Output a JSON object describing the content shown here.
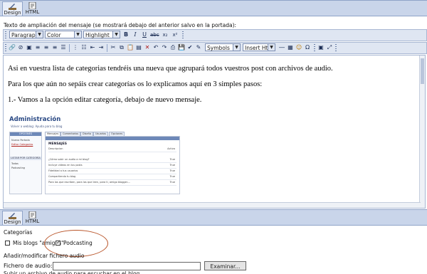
{
  "mode_tabs": {
    "design": "Design",
    "html": "HTML"
  },
  "editor_caption": "Texto de ampliación del mensaje (se mostrará debajo del anterior salvo en la portada):",
  "toolbar": {
    "format_value": "Paragraph",
    "color_value": "Color",
    "highlight_value": "Highlight",
    "symbols_value": "Symbols",
    "insert_html_value": "Insert Html"
  },
  "editor": {
    "paragraphs": [
      "Asi en vuestra lista de categorias tendréis una nueva que agrupará todos vuestros post con archivos de audio.",
      "Para los que aún no sepáis crear categorías os lo explicamos aquí en 3 simples pasos:",
      "1.- Vamos a la opción editar categoría, debajo de nuevo mensaje."
    ],
    "embedded": {
      "title": "Administración",
      "subtitle": "Volver a weblog: Ayuda para tu blog",
      "side_head": "OPCIONES",
      "side_items": [
        "Nuevo Portada",
        "Editar Categorías"
      ],
      "side_items2": [
        "LISTAR POR CATEGORÍA",
        "Todas",
        "Podcasting"
      ],
      "tabs": [
        "Mensajes",
        "Comentarios",
        "Diseño",
        "Usuarios",
        "Opciones"
      ],
      "panel_title": "MENSAJES",
      "col_desc": "Descripcion",
      "col_active": "Activo",
      "rows": [
        {
          "desc": "¿Cómo subir un audio a mi blog?",
          "active": "True"
        },
        {
          "desc": "Incluye videos en tus posts",
          "active": "True"
        },
        {
          "desc": "Fidelidad a tus usuarios",
          "active": "True"
        },
        {
          "desc": "Compartiendo tu blog",
          "active": "True"
        },
        {
          "desc": "Para los que escriben, para los que leen, para ti, amigo blogger....",
          "active": "True"
        }
      ]
    }
  },
  "categories": {
    "heading": "Categorías",
    "items": [
      {
        "label": "Mis blogs \"amigos\"",
        "checked": false
      },
      {
        "label": "Podcasting",
        "checked": true
      }
    ]
  },
  "audio": {
    "heading": "Añadir/modificar fichero audio",
    "field_label": "Fichero de audio:",
    "field_value": "",
    "browse_label": "Examinar...",
    "cut_text": "Subir un archivo de audio para escuchar en el blog..."
  }
}
